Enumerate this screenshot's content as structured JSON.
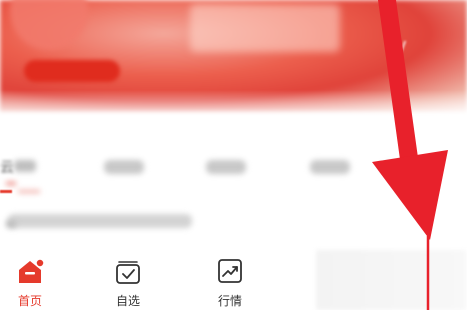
{
  "banner": {
    "partial_letter": "V"
  },
  "content": {
    "active_tab_partial": "云"
  },
  "bottom_nav": {
    "items": [
      {
        "label": "首页",
        "icon": "home-icon",
        "active": true
      },
      {
        "label": "自选",
        "icon": "watchlist-icon",
        "active": false
      },
      {
        "label": "行情",
        "icon": "market-trend-icon",
        "active": false
      }
    ]
  },
  "colors": {
    "accent": "#e53a2c",
    "arrow": "#e8212b",
    "inactive_text": "#333333",
    "banner_red": "#e0433a"
  },
  "annotation": {
    "type": "arrow",
    "color": "#e8212b",
    "direction": "down"
  }
}
